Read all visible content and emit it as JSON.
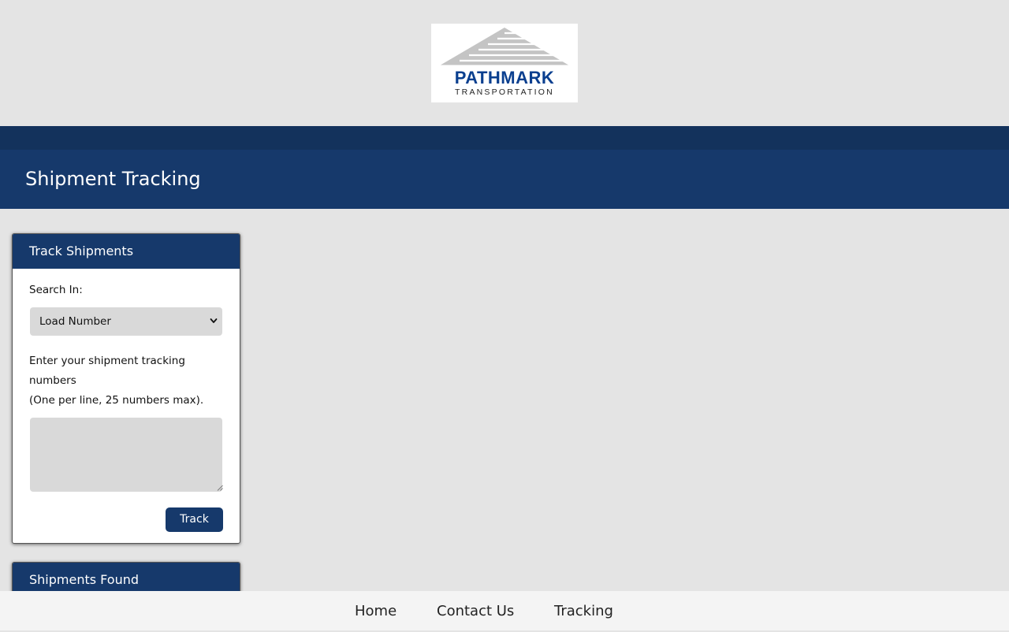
{
  "header": {
    "logo": {
      "name": "PATHMARK",
      "subtitle": "TRANSPORTATION"
    },
    "page_title": "Shipment Tracking"
  },
  "track_panel": {
    "title": "Track Shipments",
    "search_label": "Search In:",
    "search_in": {
      "selected": "Load Number"
    },
    "instructions": [
      "Enter your shipment tracking",
      "numbers",
      "(One per line, 25 numbers max)."
    ],
    "tracking_numbers_value": "",
    "track_button_label": "Track"
  },
  "found_panel": {
    "title": "Shipments Found"
  },
  "footer": {
    "links": [
      "Home",
      "Contact Us",
      "Tracking"
    ]
  },
  "colors": {
    "page_background": "#e4e4e4",
    "dark_bar": "#13325c",
    "brand_navy": "#16396b",
    "logo_blue": "#0a3f8f",
    "input_background": "#d9d9d9",
    "footer_background": "#f4f4f4"
  },
  "icons": {
    "select_arrow": "chevron-down-icon",
    "textarea_grip": "resize-grip-icon"
  }
}
